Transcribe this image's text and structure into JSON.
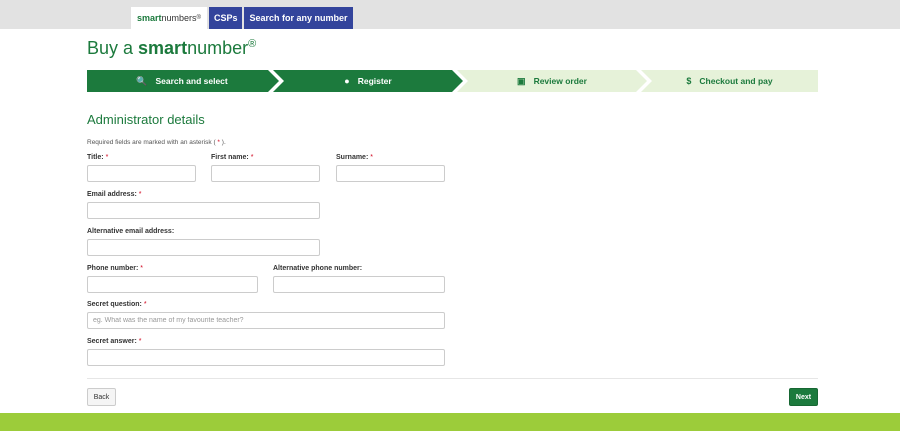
{
  "topnav": {
    "brand_prefix": "smart",
    "brand_suffix": "numbers",
    "brand_reg": "®",
    "csps": "CSPs",
    "search": "Search for any number"
  },
  "page": {
    "title_prefix": "Buy a ",
    "title_bold": "smart",
    "title_suffix": "number",
    "title_reg": "®"
  },
  "steps": [
    {
      "label": "Search and select",
      "icon": "search-icon",
      "active": true
    },
    {
      "label": "Register",
      "icon": "user-icon",
      "active": true
    },
    {
      "label": "Review order",
      "icon": "cart-icon",
      "active": false
    },
    {
      "label": "Checkout and pay",
      "icon": "dollar-icon",
      "active": false
    }
  ],
  "form": {
    "section_title": "Administrator details",
    "note_before": "Required fields are marked with an asterisk (",
    "note_asterisk": " * ",
    "note_after": ").",
    "required_mark": "*",
    "fields": {
      "title": {
        "label": "Title:",
        "value": "",
        "placeholder": ""
      },
      "first_name": {
        "label": "First name:",
        "value": "",
        "placeholder": ""
      },
      "surname": {
        "label": "Surname:",
        "value": "",
        "placeholder": ""
      },
      "email": {
        "label": "Email address:",
        "value": "",
        "placeholder": ""
      },
      "alt_email": {
        "label": "Alternative email address:",
        "value": "",
        "placeholder": ""
      },
      "phone": {
        "label": "Phone number:",
        "value": "",
        "placeholder": ""
      },
      "alt_phone": {
        "label": "Alternative phone number:",
        "value": "",
        "placeholder": ""
      },
      "secret_question": {
        "label": "Secret question:",
        "value": "",
        "placeholder": "eg. What was the name of my favourite teacher?"
      },
      "secret_answer": {
        "label": "Secret answer:",
        "value": "",
        "placeholder": ""
      }
    }
  },
  "actions": {
    "back": "Back",
    "next": "Next"
  },
  "colors": {
    "brand_green": "#1c7a3d",
    "step_inactive": "#e6f2d9",
    "nav_blue": "#33449c",
    "footer_green": "#9ccc3a",
    "required_red": "#d0021b"
  }
}
